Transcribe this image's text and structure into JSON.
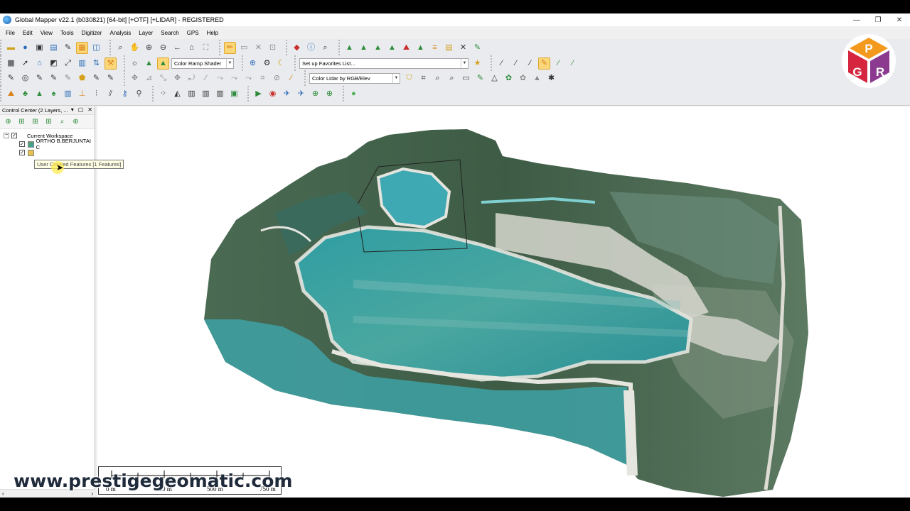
{
  "window": {
    "title": "Global Mapper v22.1 (b030821) [64-bit] [+OTF] [+LIDAR] - REGISTERED",
    "controls": {
      "minimize": "—",
      "restore": "❐",
      "close": "✕"
    }
  },
  "menu": [
    "File",
    "Edit",
    "View",
    "Tools",
    "Digitizer",
    "Analysis",
    "Layer",
    "Search",
    "GPS",
    "Help"
  ],
  "toolbar": {
    "shader_combo": "Color Ramp Shader",
    "favorites_combo": "Set up Favorites List...",
    "lidar_combo": "Color Lidar by RGB/Elev"
  },
  "control_center": {
    "title": "Control Center (2 Layers, ...",
    "workspace_label": "Current Workspace",
    "layers": [
      {
        "name": "ORTHO B.BERJUNTAI C",
        "checked": true
      },
      {
        "name": "User Created Features [1 Features]",
        "checked": true
      }
    ],
    "tooltip": "User Created Features [1 Features]"
  },
  "scale_bar": {
    "labels": [
      "0 m",
      "250 m",
      "500 m",
      "750 m"
    ]
  },
  "watermark": "www.prestigegeomatic.com",
  "logo": {
    "letters": [
      "P",
      "G",
      "R"
    ]
  },
  "colors": {
    "water": "#3aa3a6",
    "vegetation": "#3d5f3f",
    "sand": "#e3e3de",
    "logo_orange": "#f39a1e",
    "logo_red": "#d6263f",
    "logo_purple": "#8b3a8f"
  }
}
